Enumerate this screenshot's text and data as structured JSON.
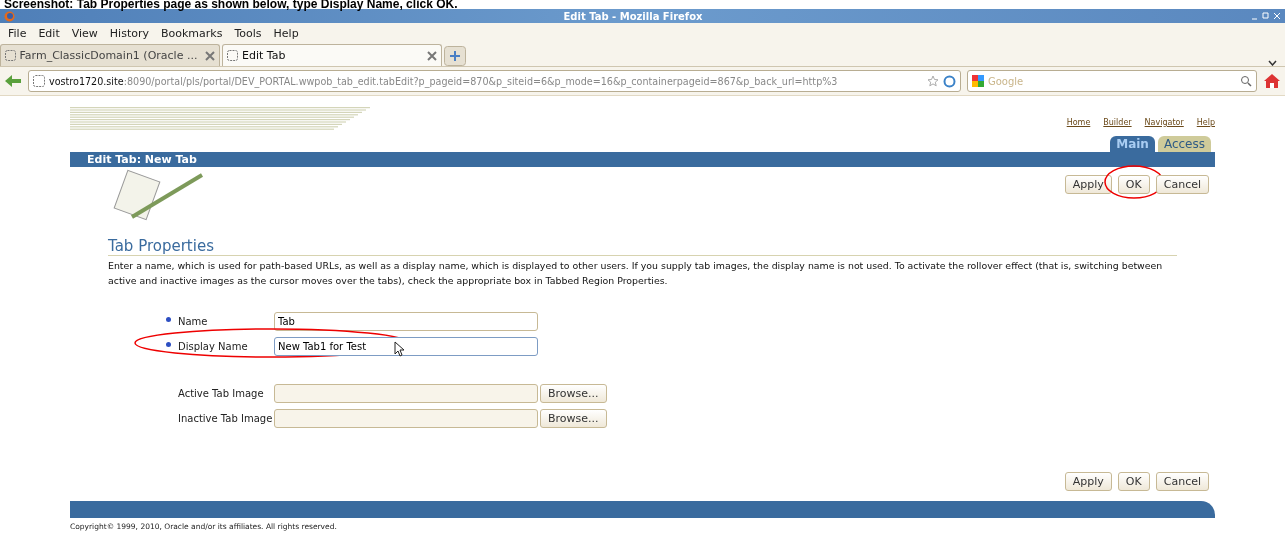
{
  "caption": "**Screenshot:** Tab Properties page as shown below, type **Display Name**, click **OK.**",
  "window": {
    "title": "Edit Tab - Mozilla Firefox"
  },
  "menu": [
    "File",
    "Edit",
    "View",
    "History",
    "Bookmarks",
    "Tools",
    "Help"
  ],
  "browser_tabs": [
    {
      "label": "Farm_ClassicDomain1 (Oracle ...",
      "selected": false
    },
    {
      "label": "Edit Tab",
      "selected": true
    }
  ],
  "address": {
    "host": "vostro1720.site",
    "rest": ":8090/portal/pls/portal/DEV_PORTAL.wwpob_tab_edit.tabEdit?p_pageid=870&p_siteid=6&p_mode=16&p_containerpageid=867&p_back_url=http%3"
  },
  "search": {
    "placeholder": "Google"
  },
  "top_links": [
    "Home",
    "Builder",
    "Navigator",
    "Help"
  ],
  "page_tabs": [
    {
      "label": "Main",
      "selected": true
    },
    {
      "label": "Access",
      "selected": false
    }
  ],
  "header_title": "Edit Tab: New Tab",
  "top_buttons": [
    {
      "label": "Apply",
      "annotated": false
    },
    {
      "label": "OK",
      "annotated": true
    },
    {
      "label": "Cancel",
      "annotated": false
    }
  ],
  "section_heading": "Tab Properties",
  "description": "Enter a name, which is used for path-based URLs, as well as a display name, which is displayed to other users. If you supply tab images, the display name is not used. To activate the rollover effect (that is, switching between active and inactive images as the cursor moves over the tabs), check the appropriate box in Tabbed Region Properties.",
  "fields": [
    {
      "kind": "text",
      "label": "Name",
      "required": true,
      "value": "Tab",
      "annotated": false,
      "focused": false
    },
    {
      "kind": "text",
      "label": "Display Name",
      "required": true,
      "value": "New Tab1 for Test",
      "annotated": true,
      "focused": true
    },
    {
      "kind": "file",
      "label": "Active Tab Image",
      "required": false,
      "button": "Browse..."
    },
    {
      "kind": "file",
      "label": "Inactive Tab Image",
      "required": false,
      "button": "Browse..."
    }
  ],
  "bottom_buttons": [
    {
      "label": "Apply",
      "annotated": false
    },
    {
      "label": "OK",
      "annotated": false
    },
    {
      "label": "Cancel",
      "annotated": false
    }
  ],
  "copyright": "Copyright© 1999, 2010, Oracle and/or its affiliates. All rights reserved."
}
